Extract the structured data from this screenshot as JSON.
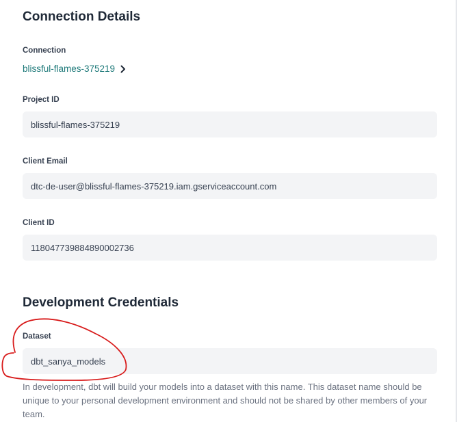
{
  "connection_details": {
    "title": "Connection Details",
    "connection": {
      "label": "Connection",
      "value": "blissful-flames-375219"
    },
    "project_id": {
      "label": "Project ID",
      "value": "blissful-flames-375219"
    },
    "client_email": {
      "label": "Client Email",
      "value": "dtc-de-user@blissful-flames-375219.iam.gserviceaccount.com"
    },
    "client_id": {
      "label": "Client ID",
      "value": "118047739884890002736"
    }
  },
  "development_credentials": {
    "title": "Development Credentials",
    "dataset": {
      "label": "Dataset",
      "value": "dbt_sanya_models",
      "help": "In development, dbt will build your models into a dataset with this name. This dataset name should be unique to your personal development environment and should not be shared by other members of your team."
    }
  },
  "colors": {
    "link": "#1f7a7a",
    "field_bg": "#f3f4f6",
    "annotation": "#d81b1b"
  },
  "icons": {
    "connection_chevron": "chevron-right-icon"
  }
}
